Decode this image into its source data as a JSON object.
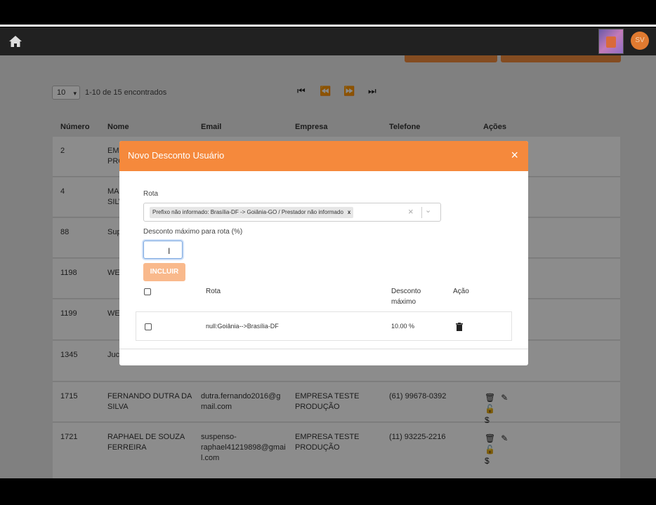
{
  "navbar": {
    "home_icon": "home-icon",
    "avatar_initials": "SV"
  },
  "list": {
    "page_size": "10",
    "count_text": "1-10 de 15 encontrados",
    "pager_icons": [
      "first-page-icon",
      "prev-page-icon",
      "next-page-icon",
      "last-page-icon"
    ],
    "columns": [
      "Número",
      "Nome",
      "Email",
      "Empresa",
      "Telefone",
      "Ações"
    ],
    "rows": [
      {
        "numero": "2",
        "nome": "EMP\nPRO",
        "email": "",
        "empresa": "",
        "telefone": ""
      },
      {
        "numero": "4",
        "nome": "MA\nSILV",
        "email": "",
        "empresa": "",
        "telefone": ""
      },
      {
        "numero": "88",
        "nome": "Sup",
        "email": "",
        "empresa": "",
        "telefone": ""
      },
      {
        "numero": "1198",
        "nome": "WE",
        "email": "",
        "empresa": "",
        "telefone": ""
      },
      {
        "numero": "1199",
        "nome": "WE",
        "email": "",
        "empresa": "",
        "telefone": ""
      },
      {
        "numero": "1345",
        "nome": "Juci",
        "email": "m",
        "empresa": "PRODUÇÃO",
        "telefone": ""
      },
      {
        "numero": "1715",
        "nome": "FERNANDO DUTRA DA\nSILVA",
        "email": "dutra.fernando2016@g\nmail.com",
        "empresa": "EMPRESA TESTE\nPRODUÇÃO",
        "telefone": "(61) 99678-0392"
      },
      {
        "numero": "1721",
        "nome": "RAPHAEL DE SOUZA\nFERREIRA",
        "email": "suspenso-\nraphael41219898@gmai\nl.com",
        "empresa": "EMPRESA TESTE\nPRODUÇÃO",
        "telefone": "(11) 93225-2216"
      }
    ],
    "action_icons": [
      "trash-icon",
      "edit-icon",
      "lock-icon",
      "dollar-icon"
    ]
  },
  "modal": {
    "title": "Novo Desconto Usuário",
    "close_glyph": "×",
    "rota_label": "Rota",
    "rota_selected": "Prefixo não informado: Brasília-DF -> Goiânia-GO / Prestador não informado",
    "chip_remove_glyph": "x",
    "clear_glyph": "×",
    "desconto_label": "Desconto máximo para rota (%)",
    "desconto_value": "",
    "incluir_label": "INCLUIR",
    "table": {
      "headers": [
        "Rota",
        "Desconto\nmáximo",
        "Ação"
      ],
      "rows": [
        {
          "rota": "null:Goiânia-->Brasília-DF",
          "desconto": "10.00 %"
        }
      ]
    }
  }
}
